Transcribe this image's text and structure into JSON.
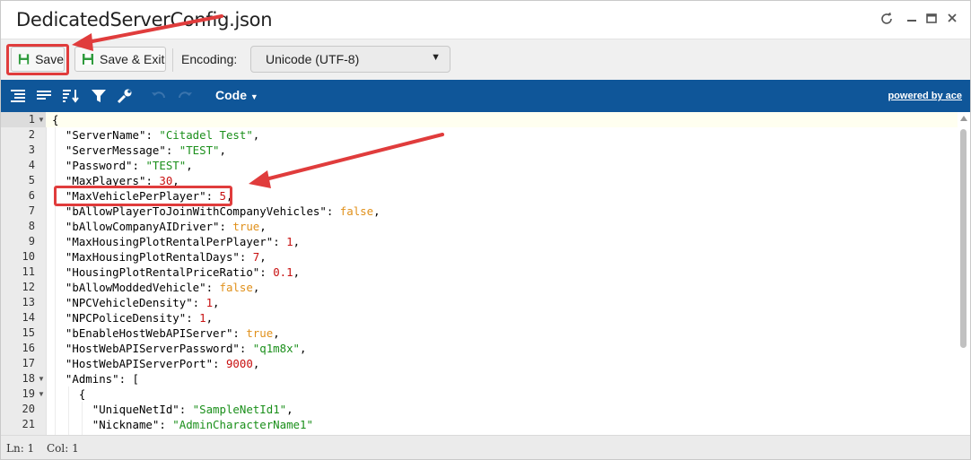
{
  "window": {
    "title": "DedicatedServerConfig.json",
    "controls": [
      "refresh-icon",
      "minimize-icon",
      "maximize-icon",
      "close-icon"
    ]
  },
  "toolbar": {
    "save_label": "Save",
    "save_exit_label": "Save & Exit",
    "encoding_label": "Encoding:",
    "encoding_value": "Unicode (UTF-8)"
  },
  "editor_toolbar": {
    "icons": [
      "format-icon",
      "compact-icon",
      "sort-icon",
      "filter-icon",
      "wrench-icon",
      "undo-icon",
      "redo-icon"
    ],
    "mode_label": "Code",
    "powered_by": "powered by ace"
  },
  "editor": {
    "lines": [
      {
        "n": "1",
        "fold": true
      },
      {
        "n": "2"
      },
      {
        "n": "3"
      },
      {
        "n": "4"
      },
      {
        "n": "5"
      },
      {
        "n": "6"
      },
      {
        "n": "7"
      },
      {
        "n": "8"
      },
      {
        "n": "9"
      },
      {
        "n": "10"
      },
      {
        "n": "11"
      },
      {
        "n": "12"
      },
      {
        "n": "13"
      },
      {
        "n": "14"
      },
      {
        "n": "15"
      },
      {
        "n": "16"
      },
      {
        "n": "17"
      },
      {
        "n": "18",
        "fold": true
      },
      {
        "n": "19",
        "fold": true
      },
      {
        "n": "20"
      },
      {
        "n": "21"
      }
    ],
    "code": [
      [
        [
          "p",
          "{"
        ]
      ],
      [
        [
          "k",
          "  \"ServerName\""
        ],
        [
          "p",
          ": "
        ],
        [
          "s",
          "\"Citadel Test\""
        ],
        [
          "p",
          ","
        ]
      ],
      [
        [
          "k",
          "  \"ServerMessage\""
        ],
        [
          "p",
          ": "
        ],
        [
          "s",
          "\"TEST\""
        ],
        [
          "p",
          ","
        ]
      ],
      [
        [
          "k",
          "  \"Password\""
        ],
        [
          "p",
          ": "
        ],
        [
          "s",
          "\"TEST\""
        ],
        [
          "p",
          ","
        ]
      ],
      [
        [
          "k",
          "  \"MaxPlayers\""
        ],
        [
          "p",
          ": "
        ],
        [
          "n",
          "30"
        ],
        [
          "p",
          ","
        ]
      ],
      [
        [
          "k",
          "  \"MaxVehiclePerPlayer\""
        ],
        [
          "p",
          ": "
        ],
        [
          "n",
          "5"
        ],
        [
          "p",
          ","
        ]
      ],
      [
        [
          "k",
          "  \"bAllowPlayerToJoinWithCompanyVehicles\""
        ],
        [
          "p",
          ": "
        ],
        [
          "b",
          "false"
        ],
        [
          "p",
          ","
        ]
      ],
      [
        [
          "k",
          "  \"bAllowCompanyAIDriver\""
        ],
        [
          "p",
          ": "
        ],
        [
          "b",
          "true"
        ],
        [
          "p",
          ","
        ]
      ],
      [
        [
          "k",
          "  \"MaxHousingPlotRentalPerPlayer\""
        ],
        [
          "p",
          ": "
        ],
        [
          "n",
          "1"
        ],
        [
          "p",
          ","
        ]
      ],
      [
        [
          "k",
          "  \"MaxHousingPlotRentalDays\""
        ],
        [
          "p",
          ": "
        ],
        [
          "n",
          "7"
        ],
        [
          "p",
          ","
        ]
      ],
      [
        [
          "k",
          "  \"HousingPlotRentalPriceRatio\""
        ],
        [
          "p",
          ": "
        ],
        [
          "n",
          "0.1"
        ],
        [
          "p",
          ","
        ]
      ],
      [
        [
          "k",
          "  \"bAllowModdedVehicle\""
        ],
        [
          "p",
          ": "
        ],
        [
          "b",
          "false"
        ],
        [
          "p",
          ","
        ]
      ],
      [
        [
          "k",
          "  \"NPCVehicleDensity\""
        ],
        [
          "p",
          ": "
        ],
        [
          "n",
          "1"
        ],
        [
          "p",
          ","
        ]
      ],
      [
        [
          "k",
          "  \"NPCPoliceDensity\""
        ],
        [
          "p",
          ": "
        ],
        [
          "n",
          "1"
        ],
        [
          "p",
          ","
        ]
      ],
      [
        [
          "k",
          "  \"bEnableHostWebAPIServer\""
        ],
        [
          "p",
          ": "
        ],
        [
          "b",
          "true"
        ],
        [
          "p",
          ","
        ]
      ],
      [
        [
          "k",
          "  \"HostWebAPIServerPassword\""
        ],
        [
          "p",
          ": "
        ],
        [
          "s",
          "\"q1m8x\""
        ],
        [
          "p",
          ","
        ]
      ],
      [
        [
          "k",
          "  \"HostWebAPIServerPort\""
        ],
        [
          "p",
          ": "
        ],
        [
          "n",
          "9000"
        ],
        [
          "p",
          ","
        ]
      ],
      [
        [
          "k",
          "  \"Admins\""
        ],
        [
          "p",
          ": ["
        ]
      ],
      [
        [
          "p",
          "    {"
        ]
      ],
      [
        [
          "k",
          "      \"UniqueNetId\""
        ],
        [
          "p",
          ": "
        ],
        [
          "s",
          "\"SampleNetId1\""
        ],
        [
          "p",
          ","
        ]
      ],
      [
        [
          "k",
          "      \"Nickname\""
        ],
        [
          "p",
          ": "
        ],
        [
          "s",
          "\"AdminCharacterName1\""
        ]
      ]
    ]
  },
  "status": {
    "line": "Ln: 1",
    "col": "Col: 1"
  },
  "colors": {
    "ace_bar": "#0f5699",
    "annotation_red": "#e03c3c",
    "string": "#1a8f1a",
    "number": "#c81010",
    "boolean": "#e0901a"
  }
}
